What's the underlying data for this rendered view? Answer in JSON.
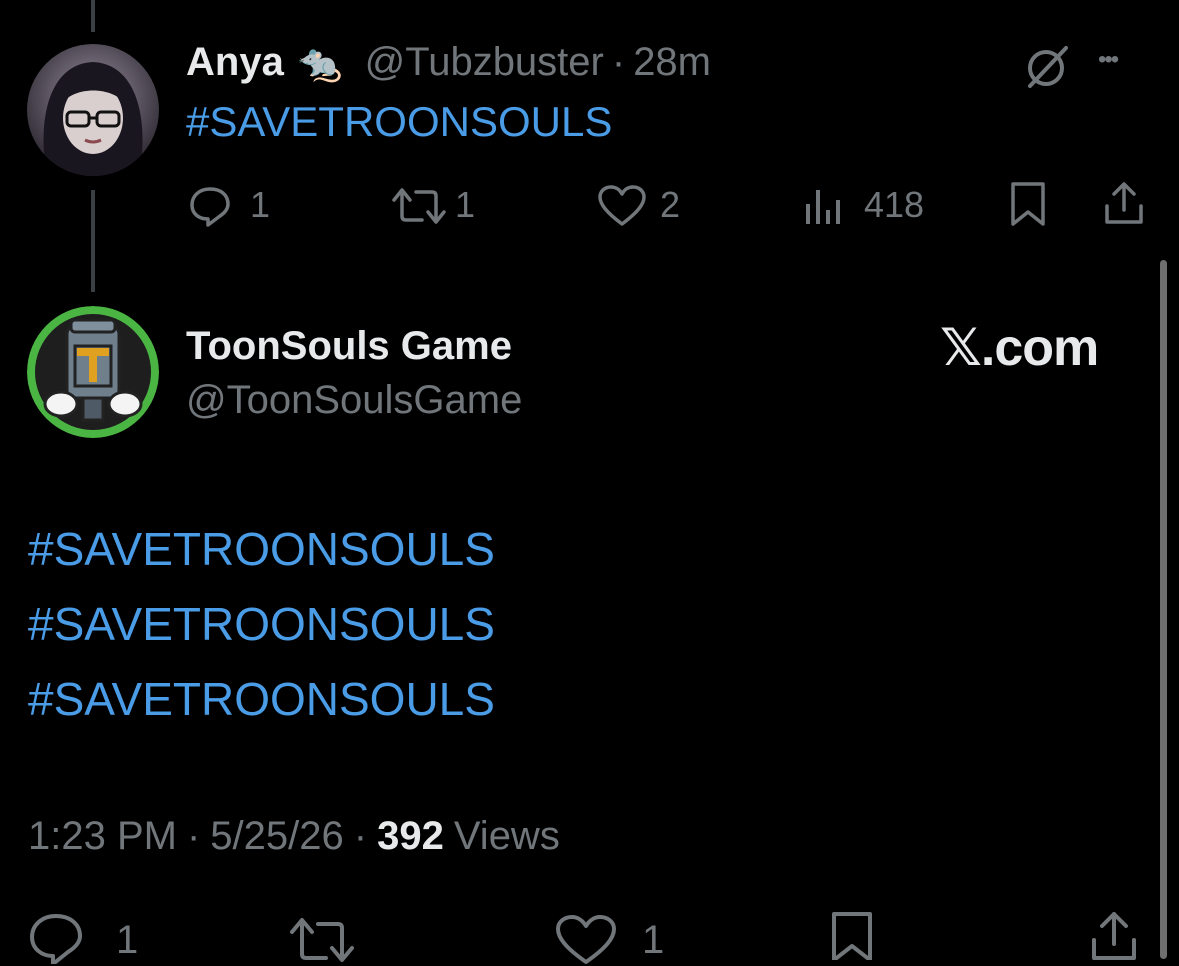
{
  "reply": {
    "display_name": "Anya",
    "emoji": "🐀",
    "handle": "@Tubzbuster",
    "separator": "·",
    "time_ago": "28m",
    "text": "#SAVETROONSOULS",
    "more": "•••",
    "stats": {
      "replies": "1",
      "reposts": "1",
      "likes": "2",
      "views": "418"
    }
  },
  "main": {
    "display_name": "ToonSouls Game",
    "handle": "@ToonSoulsGame",
    "brand": "𝕏.com",
    "lines": [
      "#SAVETROONSOULS",
      "#SAVETROONSOULS",
      "#SAVETROONSOULS"
    ],
    "time": "1:23 PM",
    "sep1": "·",
    "date": "5/25/26",
    "sep2": "·",
    "views_count": "392",
    "views_label": "Views",
    "stats": {
      "replies": "1",
      "likes": "1"
    }
  },
  "colors": {
    "background": "#000000",
    "link": "#4a9ce6",
    "muted": "#71767b",
    "text": "#e7e9ea"
  }
}
